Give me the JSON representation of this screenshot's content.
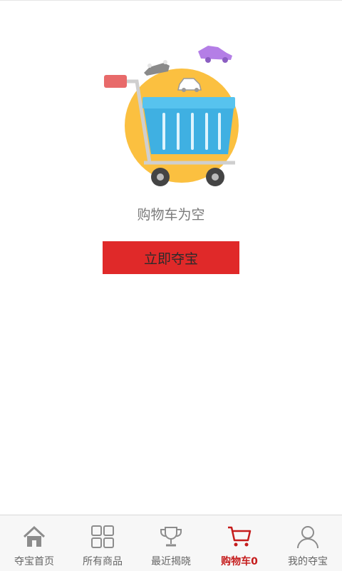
{
  "empty_state": {
    "message": "购物车为空",
    "cta_label": "立即夺宝"
  },
  "colors": {
    "accent": "#e02929",
    "active_tab": "#c51c1c",
    "circle": "#fbc040",
    "basket": "#3fb0e2"
  },
  "tabs": [
    {
      "label": "夺宝首页",
      "icon": "home-icon"
    },
    {
      "label": "所有商品",
      "icon": "grid-icon"
    },
    {
      "label": "最近揭晓",
      "icon": "trophy-icon"
    },
    {
      "label": "购物车0",
      "icon": "cart-icon",
      "active": true
    },
    {
      "label": "我的夺宝",
      "icon": "user-icon"
    }
  ]
}
